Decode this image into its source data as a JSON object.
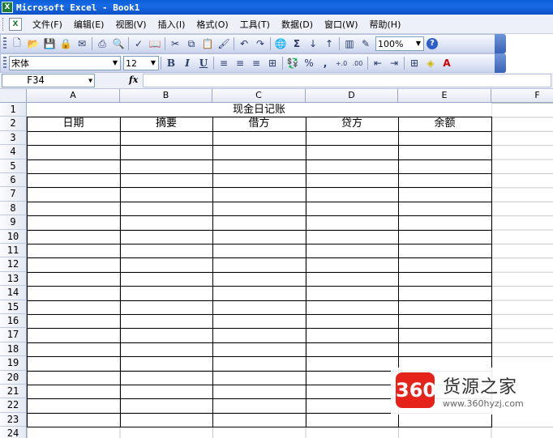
{
  "window": {
    "title": "Microsoft Excel - Book1"
  },
  "menu": {
    "items": [
      "文件(F)",
      "编辑(E)",
      "视图(V)",
      "插入(I)",
      "格式(O)",
      "工具(T)",
      "数据(D)",
      "窗口(W)",
      "帮助(H)"
    ]
  },
  "toolbar": {
    "zoom": "100%",
    "font_name": "宋体",
    "font_size": "12",
    "percent_symbol": "%",
    "comma_symbol": ",",
    "increase_decimal": "+.0",
    "decrease_decimal": ".00"
  },
  "formula_bar": {
    "name_box": "F34",
    "fx": "fx",
    "formula": ""
  },
  "sheet": {
    "columns": [
      "A",
      "B",
      "C",
      "D",
      "E",
      "F"
    ],
    "rows": [
      "1",
      "2",
      "3",
      "4",
      "5",
      "6",
      "7",
      "8",
      "9",
      "10",
      "11",
      "12",
      "13",
      "14",
      "15",
      "16",
      "17",
      "18",
      "19",
      "20",
      "21",
      "22",
      "23",
      "24"
    ],
    "title_cell": "现金日记账",
    "headers": [
      "日期",
      "摘要",
      "借方",
      "贷方",
      "余额"
    ]
  },
  "watermark": {
    "badge": "360",
    "name": "货源之家",
    "url": "www.360hyzj.com"
  },
  "colors": {
    "titlebar": "#0a5fd8",
    "badge": "#e5231b"
  }
}
